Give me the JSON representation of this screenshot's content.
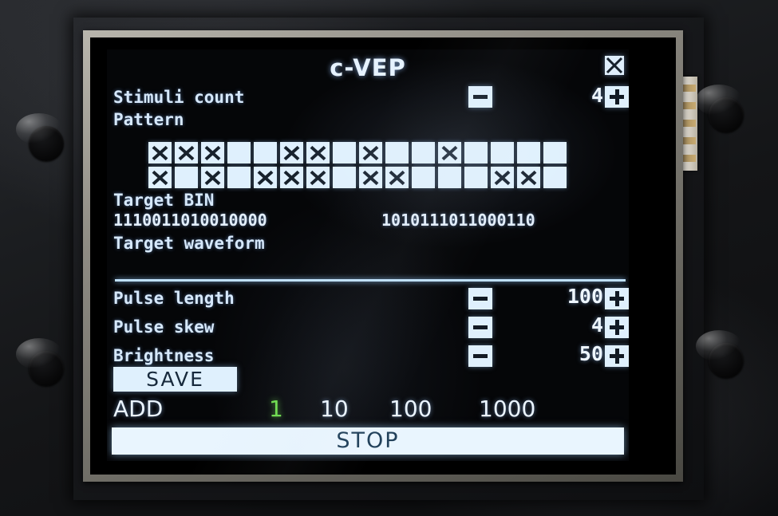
{
  "screen": {
    "title": "c-VEP",
    "close_icon": "close-x-icon",
    "accent_text_color": "#d9e9fb",
    "panel_color": "#dff0fd",
    "active_step_color": "#6ddc4a"
  },
  "stimuli": {
    "label": "Stimuli count",
    "value": "4",
    "minus_label": "-",
    "plus_label": "+"
  },
  "pattern": {
    "label": "Pattern",
    "rows": [
      [
        1,
        1,
        1,
        0,
        0,
        1,
        1,
        0,
        1,
        0,
        0,
        1,
        0,
        0,
        0,
        0
      ],
      [
        1,
        0,
        1,
        0,
        1,
        1,
        1,
        0,
        1,
        1,
        0,
        0,
        0,
        1,
        1,
        0
      ]
    ]
  },
  "target_bin": {
    "label": "Target BIN",
    "left": "1110011010010000",
    "right": "1010111011000110"
  },
  "target_waveform": {
    "label": "Target waveform"
  },
  "settings": [
    {
      "label": "Pulse length",
      "value": "100",
      "minus_label": "-",
      "plus_label": "+"
    },
    {
      "label": "Pulse skew",
      "value": "4",
      "minus_label": "-",
      "plus_label": "+"
    },
    {
      "label": "Brightness",
      "value": "50",
      "minus_label": "-",
      "plus_label": "+"
    }
  ],
  "actions": {
    "save_label": "SAVE",
    "add_label": "ADD",
    "steps": [
      {
        "label": "1",
        "active": true
      },
      {
        "label": "10",
        "active": false
      },
      {
        "label": "100",
        "active": false
      },
      {
        "label": "1000",
        "active": false
      }
    ],
    "stop_label": "STOP"
  }
}
